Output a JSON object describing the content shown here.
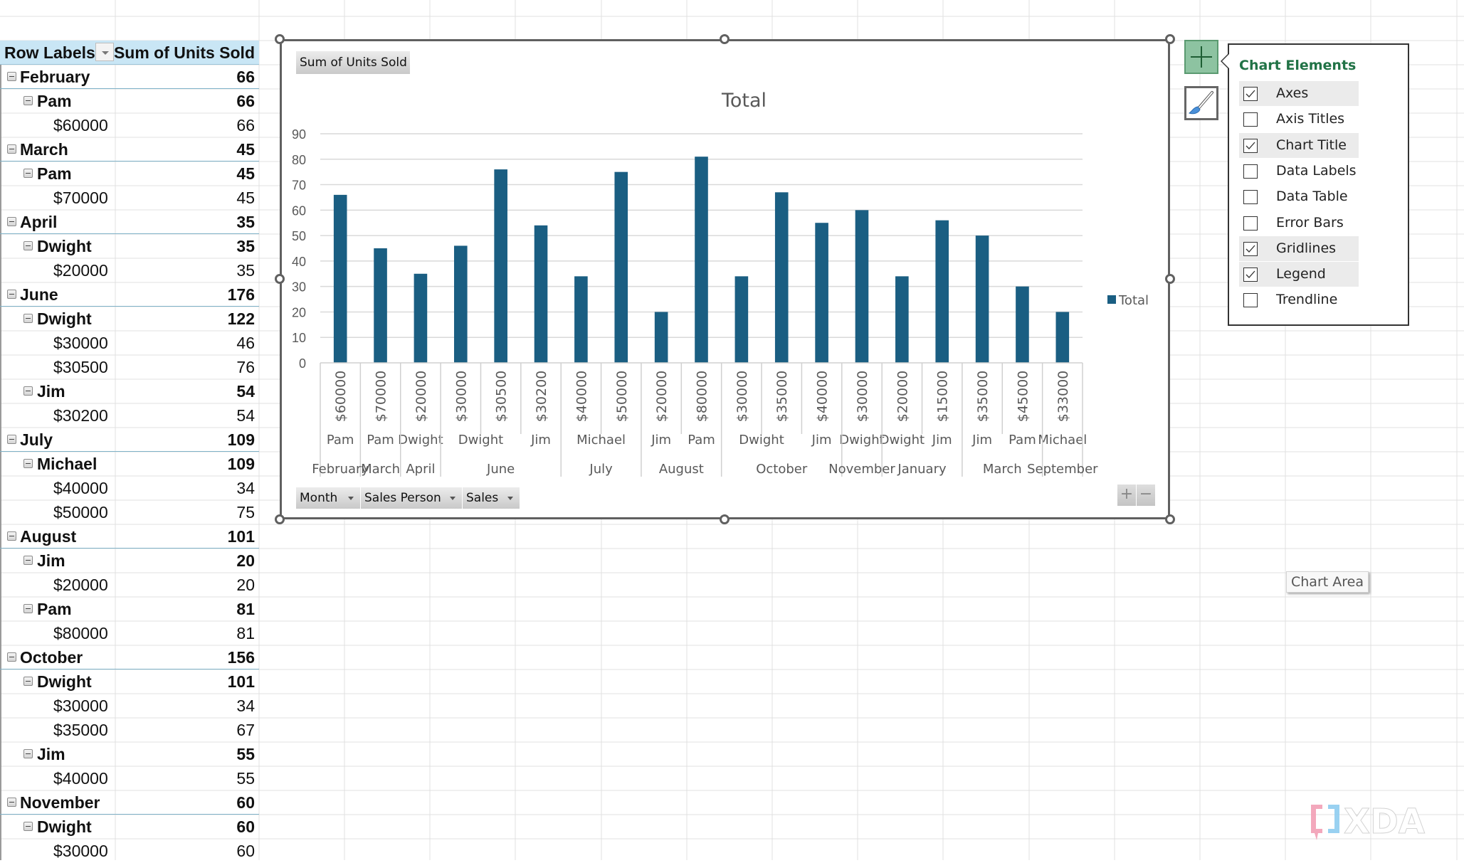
{
  "pivot": {
    "header": {
      "row_labels": "Row Labels",
      "value_header": "Sum of Units Sold"
    },
    "rows": [
      {
        "level": 0,
        "label": "February",
        "value": "66"
      },
      {
        "level": 1,
        "label": "Pam",
        "value": "66"
      },
      {
        "level": 2,
        "label": "$60000",
        "value": "66"
      },
      {
        "level": 0,
        "label": "March",
        "value": "45"
      },
      {
        "level": 1,
        "label": "Pam",
        "value": "45"
      },
      {
        "level": 2,
        "label": "$70000",
        "value": "45"
      },
      {
        "level": 0,
        "label": "April",
        "value": "35"
      },
      {
        "level": 1,
        "label": "Dwight",
        "value": "35"
      },
      {
        "level": 2,
        "label": "$20000",
        "value": "35"
      },
      {
        "level": 0,
        "label": "June",
        "value": "176"
      },
      {
        "level": 1,
        "label": "Dwight",
        "value": "122"
      },
      {
        "level": 2,
        "label": "$30000",
        "value": "46"
      },
      {
        "level": 2,
        "label": "$30500",
        "value": "76"
      },
      {
        "level": 1,
        "label": "Jim",
        "value": "54"
      },
      {
        "level": 2,
        "label": "$30200",
        "value": "54"
      },
      {
        "level": 0,
        "label": "July",
        "value": "109"
      },
      {
        "level": 1,
        "label": "Michael",
        "value": "109"
      },
      {
        "level": 2,
        "label": "$40000",
        "value": "34"
      },
      {
        "level": 2,
        "label": "$50000",
        "value": "75"
      },
      {
        "level": 0,
        "label": "August",
        "value": "101"
      },
      {
        "level": 1,
        "label": "Jim",
        "value": "20"
      },
      {
        "level": 2,
        "label": "$20000",
        "value": "20"
      },
      {
        "level": 1,
        "label": "Pam",
        "value": "81"
      },
      {
        "level": 2,
        "label": "$80000",
        "value": "81"
      },
      {
        "level": 0,
        "label": "October",
        "value": "156"
      },
      {
        "level": 1,
        "label": "Dwight",
        "value": "101"
      },
      {
        "level": 2,
        "label": "$30000",
        "value": "34"
      },
      {
        "level": 2,
        "label": "$35000",
        "value": "67"
      },
      {
        "level": 1,
        "label": "Jim",
        "value": "55"
      },
      {
        "level": 2,
        "label": "$40000",
        "value": "55"
      },
      {
        "level": 0,
        "label": "November",
        "value": "60"
      },
      {
        "level": 1,
        "label": "Dwight",
        "value": "60"
      },
      {
        "level": 2,
        "label": "$30000",
        "value": "60"
      }
    ]
  },
  "chart": {
    "value_field_button": "Sum of Units Sold",
    "field_buttons": [
      {
        "label": "Month"
      },
      {
        "label": "Sales Person"
      },
      {
        "label": "Sales"
      }
    ],
    "zoom_buttons": {
      "expand": "+",
      "collapse": "−"
    }
  },
  "chart_data": {
    "type": "bar",
    "title": "Total",
    "xlabel": "",
    "ylabel": "",
    "ylim": [
      0,
      90
    ],
    "yticks": [
      0,
      10,
      20,
      30,
      40,
      50,
      60,
      70,
      80,
      90
    ],
    "grid": true,
    "legend": {
      "position": "right",
      "entries": [
        "Total"
      ]
    },
    "color": "#1a5e82",
    "categories": [
      "$60000",
      "$70000",
      "$20000",
      "$30000",
      "$30500",
      "$30200",
      "$40000",
      "$50000",
      "$20000",
      "$80000",
      "$30000",
      "$35000",
      "$40000",
      "$30000",
      "$20000",
      "$15000",
      "$35000",
      "$45000",
      "$33000"
    ],
    "series": [
      {
        "name": "Total",
        "values": [
          66,
          45,
          35,
          46,
          76,
          54,
          34,
          75,
          20,
          81,
          34,
          67,
          55,
          60,
          34,
          56,
          50,
          30,
          20
        ]
      }
    ],
    "level2_groups": [
      {
        "label": "Pam",
        "start": 0,
        "span": 1
      },
      {
        "label": "Pam",
        "start": 1,
        "span": 1
      },
      {
        "label": "Dwight",
        "start": 2,
        "span": 1
      },
      {
        "label": "Dwight",
        "start": 3,
        "span": 2
      },
      {
        "label": "Jim",
        "start": 5,
        "span": 1
      },
      {
        "label": "Michael",
        "start": 6,
        "span": 2
      },
      {
        "label": "Jim",
        "start": 8,
        "span": 1
      },
      {
        "label": "Pam",
        "start": 9,
        "span": 1
      },
      {
        "label": "Dwight",
        "start": 10,
        "span": 2
      },
      {
        "label": "Jim",
        "start": 12,
        "span": 1
      },
      {
        "label": "Dwight",
        "start": 13,
        "span": 1
      },
      {
        "label": "Dwight",
        "start": 14,
        "span": 1
      },
      {
        "label": "Jim",
        "start": 15,
        "span": 1
      },
      {
        "label": "Jim",
        "start": 16,
        "span": 1
      },
      {
        "label": "Pam",
        "start": 17,
        "span": 1
      },
      {
        "label": "Michael",
        "start": 18,
        "span": 1
      }
    ],
    "level3_groups": [
      {
        "label": "February",
        "start": 0,
        "span": 1
      },
      {
        "label": "March",
        "start": 1,
        "span": 1
      },
      {
        "label": "April",
        "start": 2,
        "span": 1
      },
      {
        "label": "June",
        "start": 3,
        "span": 3
      },
      {
        "label": "July",
        "start": 6,
        "span": 2
      },
      {
        "label": "August",
        "start": 8,
        "span": 2
      },
      {
        "label": "October",
        "start": 10,
        "span": 3
      },
      {
        "label": "November",
        "start": 13,
        "span": 1
      },
      {
        "label": "January",
        "start": 14,
        "span": 2
      },
      {
        "label": "March",
        "start": 16,
        "span": 2
      },
      {
        "label": "September",
        "start": 18,
        "span": 1
      }
    ]
  },
  "side_buttons": {
    "chart_elements_icon": "plus-icon",
    "chart_styles_icon": "paintbrush-icon"
  },
  "chart_elements": {
    "title": "Chart Elements",
    "items": [
      {
        "label": "Axes",
        "checked": true
      },
      {
        "label": "Axis Titles",
        "checked": false
      },
      {
        "label": "Chart Title",
        "checked": true
      },
      {
        "label": "Data Labels",
        "checked": false
      },
      {
        "label": "Data Table",
        "checked": false
      },
      {
        "label": "Error Bars",
        "checked": false
      },
      {
        "label": "Gridlines",
        "checked": true
      },
      {
        "label": "Legend",
        "checked": true
      },
      {
        "label": "Trendline",
        "checked": false
      }
    ]
  },
  "tooltip": "Chart Area",
  "watermark": "XDA",
  "colors": {
    "bar": "#1a5e82",
    "accent_green": "#217346",
    "pivot_header_bg": "#c9e6f5"
  }
}
